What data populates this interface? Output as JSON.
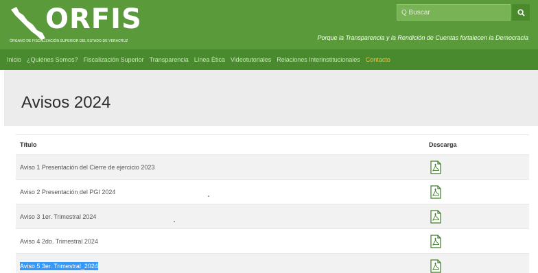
{
  "header": {
    "logo_text": "ORFIS",
    "logo_subtitle": "ÓRGANO DE FISCALIZACIÓN SUPERIOR DEL ESTADO DE VERACRUZ",
    "tagline": "Porque la Transparencia y la Rendición de Cuentas fortalecen la Democracia",
    "search_placeholder": "Q Buscar",
    "search_icon": "search-icon"
  },
  "nav": {
    "items": [
      {
        "label": "Inicio"
      },
      {
        "label": "¿Quiénes Somos?"
      },
      {
        "label": "Fiscalización Superior"
      },
      {
        "label": "Transparencia"
      },
      {
        "label": "Línea Ética"
      },
      {
        "label": "Videotutoriales"
      },
      {
        "label": "Relaciones Interinstitucionales"
      },
      {
        "label": "Contacto",
        "active": true
      }
    ]
  },
  "page": {
    "title": "Avisos 2024"
  },
  "table": {
    "columns": [
      "Título",
      "Descarga"
    ],
    "rows": [
      {
        "title": "Aviso 1 Presentación del Cierre de ejercicio 2023",
        "icon": "pdf-icon"
      },
      {
        "title": "Aviso 2 Presentación del PGI 2024",
        "icon": "pdf-icon"
      },
      {
        "title": "Aviso 3 1er. Trimestral 2024",
        "icon": "pdf-icon"
      },
      {
        "title": "Aviso 4 2do. Trimestral 2024",
        "icon": "pdf-icon"
      },
      {
        "title": "Aviso 5 3er. Trimestral_2024",
        "icon": "pdf-icon",
        "selected": true
      }
    ]
  },
  "colors": {
    "header": "#5a9a3a",
    "nav": "#4a8a2e",
    "nav_active": "#f5c342",
    "selection": "#3399ff"
  }
}
